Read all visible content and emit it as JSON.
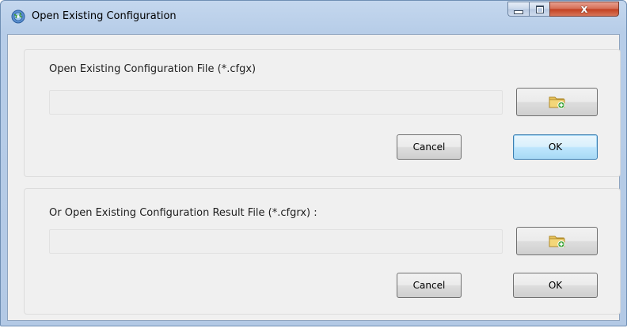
{
  "window": {
    "title": "Open Existing Configuration",
    "icon": "config-globe-icon",
    "controls": {
      "minimize": "minimize-icon",
      "maximize": "maximize-icon",
      "close": "x"
    }
  },
  "config_file": {
    "label": "Open Existing Configuration File (*.cfgx)",
    "path_value": "",
    "browse_icon": "folder-add-icon",
    "cancel_label": "Cancel",
    "ok_label": "OK"
  },
  "result_file": {
    "label": "Or Open Existing Configuration Result File (*.cfgrx) :",
    "path_value": "",
    "browse_icon": "folder-add-icon",
    "cancel_label": "Cancel",
    "ok_label": "OK"
  },
  "colors": {
    "titlebar": "#b7cde8",
    "client_bg": "#f0f0f0",
    "close_button": "#c23f1f",
    "default_button_border": "#3c7fb1",
    "folder": "#e8c35a",
    "folder_plus": "#3fa33a"
  }
}
